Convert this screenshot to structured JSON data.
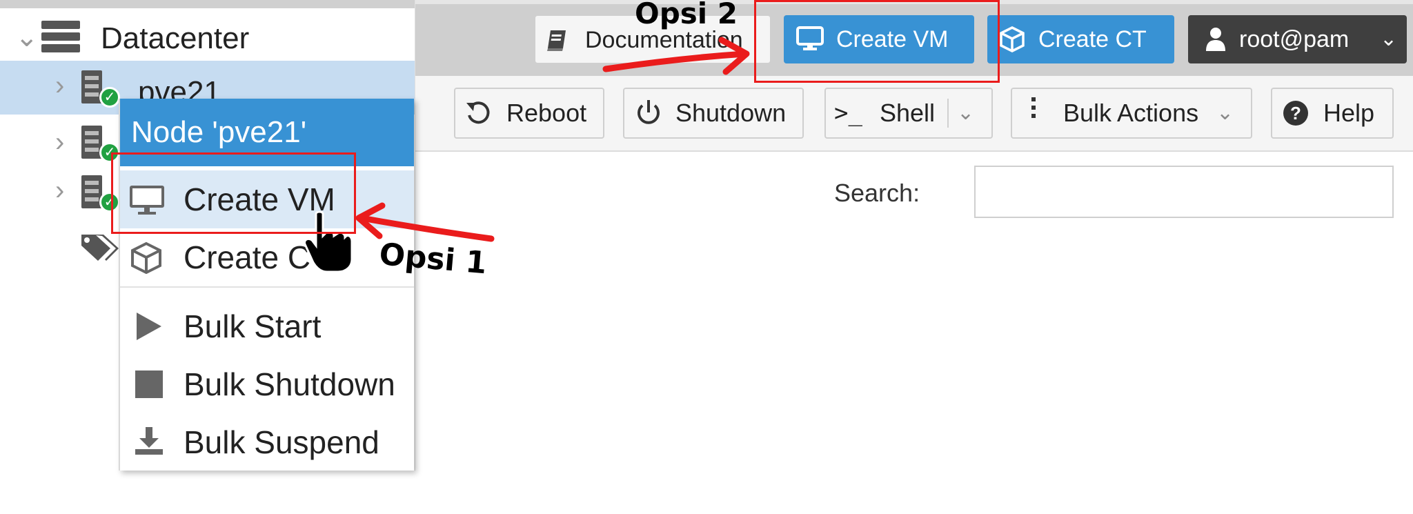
{
  "tree": {
    "datacenter_label": "Datacenter",
    "nodes": [
      {
        "label": "pve21",
        "status": "online"
      },
      {
        "label": "",
        "status": "online"
      },
      {
        "label": "",
        "status": "online"
      }
    ]
  },
  "header": {
    "documentation_label": "Documentation",
    "create_vm_label": "Create VM",
    "create_ct_label": "Create CT",
    "user_label": "root@pam"
  },
  "toolbar": {
    "reboot_label": "Reboot",
    "shutdown_label": "Shutdown",
    "shell_label": "Shell",
    "bulk_actions_label": "Bulk Actions",
    "help_label": "Help"
  },
  "search": {
    "label": "Search:",
    "value": ""
  },
  "context_menu": {
    "title": "Node 'pve21'",
    "items": [
      {
        "label": "Create VM",
        "icon": "monitor-icon"
      },
      {
        "label": "Create CT",
        "icon": "cube-icon"
      },
      {
        "label": "Bulk Start",
        "icon": "play-icon"
      },
      {
        "label": "Bulk Shutdown",
        "icon": "stop-icon"
      },
      {
        "label": "Bulk Suspend",
        "icon": "download-icon"
      }
    ]
  },
  "annotations": {
    "option1": "Opsi 1",
    "option2": "Opsi 2"
  },
  "colors": {
    "accent_blue": "#3892d4",
    "selection_blue": "#c6dcf1",
    "annotation_red": "#ea1c1c",
    "status_green": "#21a142",
    "user_button_dark": "#3f3f3f"
  }
}
